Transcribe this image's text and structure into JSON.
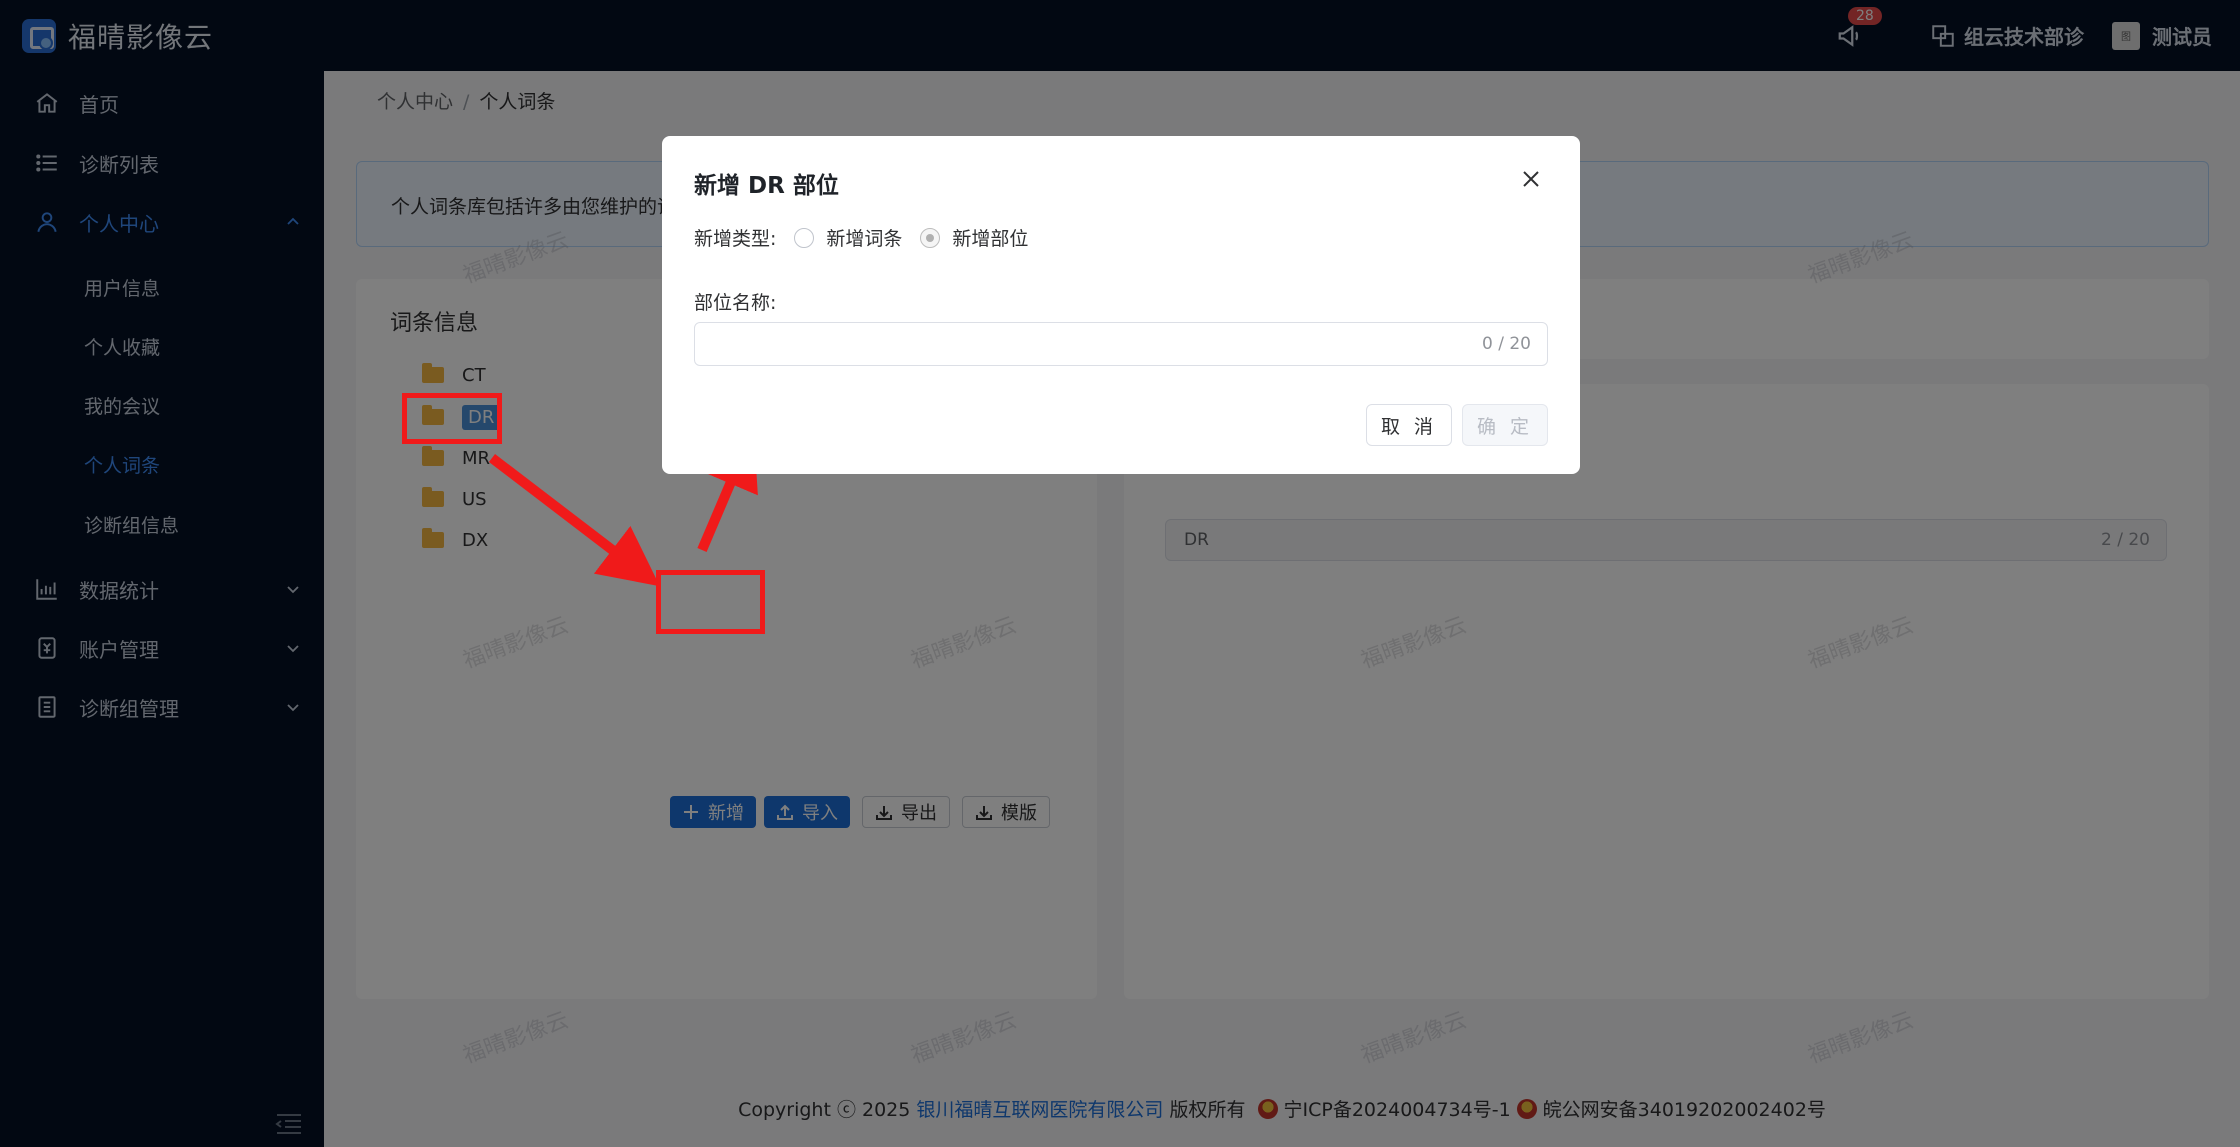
{
  "app": {
    "title": "福晴影像云"
  },
  "header": {
    "notification_count": "28",
    "org_name": "组云技术部诊",
    "user_name": "测试员",
    "avatar_text": "图"
  },
  "sidebar": {
    "items": [
      {
        "label": "首页",
        "icon": "home-icon"
      },
      {
        "label": "诊断列表",
        "icon": "list-icon"
      },
      {
        "label": "个人中心",
        "icon": "user-icon",
        "expanded": true
      },
      {
        "label": "数据统计",
        "icon": "chart-icon"
      },
      {
        "label": "账户管理",
        "icon": "wallet-icon"
      },
      {
        "label": "诊断组管理",
        "icon": "document-icon"
      }
    ],
    "sub_items": [
      {
        "label": "用户信息"
      },
      {
        "label": "个人收藏"
      },
      {
        "label": "我的会议"
      },
      {
        "label": "个人词条",
        "active": true
      },
      {
        "label": "诊断组信息"
      }
    ]
  },
  "breadcrumb": {
    "parent": "个人中心",
    "separator": "/",
    "current": "个人词条"
  },
  "notice": {
    "text": "个人词条库包括许多由您维护的词"
  },
  "left_card": {
    "title": "词条信息",
    "tree": [
      {
        "label": "CT"
      },
      {
        "label": "DR",
        "selected": true
      },
      {
        "label": "MR"
      },
      {
        "label": "US"
      },
      {
        "label": "DX"
      }
    ],
    "buttons": {
      "add": "新增",
      "import": "导入",
      "export": "导出",
      "template": "模版"
    }
  },
  "right_card": {
    "input_value": "DR",
    "input_count": "2 / 20"
  },
  "dialog": {
    "title": "新增 DR 部位",
    "type_label": "新增类型:",
    "option_entry": "新增词条",
    "option_part": "新增部位",
    "selected_option": "新增部位",
    "name_label": "部位名称:",
    "name_value": "",
    "name_count": "0 / 20",
    "cancel": "取 消",
    "confirm": "确 定"
  },
  "footer": {
    "prefix": "Copyright ",
    "copyright_symbol": "ⓒ",
    "year": " 2025 ",
    "company": "银川福晴互联网医院有限公司",
    "rights": " 版权所有 ",
    "icp": "宁ICP备2024004734号-1",
    "police": "皖公网安备34019202002402号"
  },
  "watermark": {
    "text": "福晴影像云"
  },
  "colors": {
    "accent": "#1c6fd8",
    "sidebar_bg": "#041125",
    "annotation": "#f01a1a"
  }
}
